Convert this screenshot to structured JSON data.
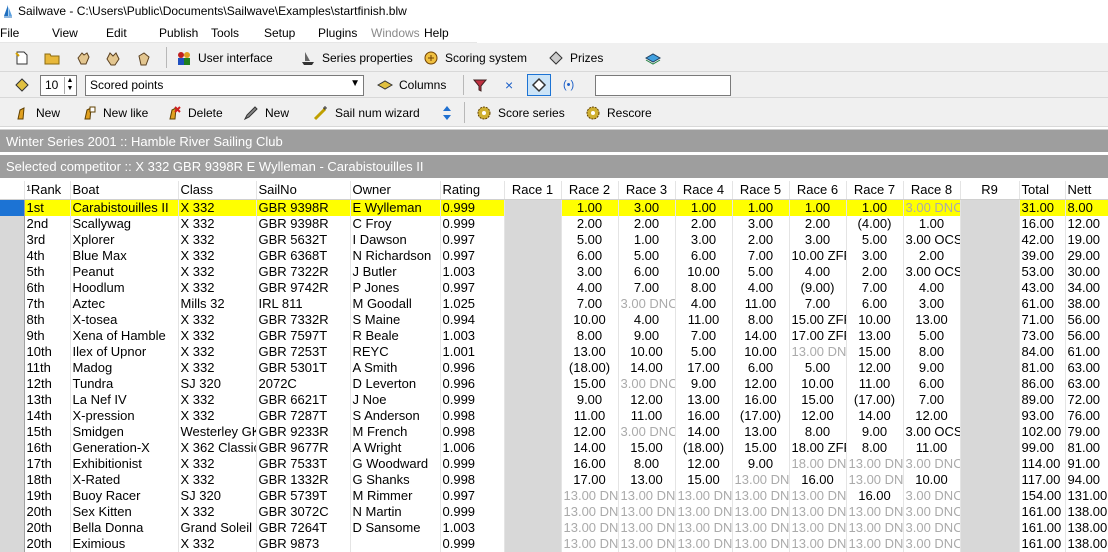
{
  "window": {
    "title": "Sailwave - C:\\Users\\Public\\Documents\\Sailwave\\Examples\\startfinish.blw"
  },
  "menu": [
    "File",
    "View",
    "Edit",
    "Publish",
    "Tools",
    "Setup",
    "Plugins",
    "Windows",
    "Help"
  ],
  "toolbar1": {
    "ui_label": "User interface",
    "series_props_label": "Series properties",
    "scoring_label": "Scoring system",
    "prizes_label": "Prizes"
  },
  "toolbar2": {
    "count": "10",
    "view_select": "Scored points",
    "columns_label": "Columns",
    "x_symbol": "×",
    "paren_symbol": "(•)",
    "search_value": ""
  },
  "toolbar3": {
    "new_label": "New",
    "new_like_label": "New like",
    "delete_label": "Delete",
    "new2_label": "New",
    "wizard_label": "Sail num wizard",
    "score_label": "Score series",
    "rescore_label": "Rescore"
  },
  "series_title": "Winter Series 2001 :: Hamble River Sailing Club",
  "selected_text": "Selected competitor :: X 332 GBR 9398R E Wylleman - Carabistouilles II",
  "columns": [
    "¹Rank",
    "Boat",
    "Class",
    "SailNo",
    "Owner",
    "Rating",
    "Race 1",
    "Race 2",
    "Race 3",
    "Race 4",
    "Race 5",
    "Race 6",
    "Race 7",
    "Race 8",
    "R9",
    "Total",
    "Nett"
  ],
  "rows": [
    [
      "1st",
      "Carabistouilles II",
      "X 332",
      "GBR 9398R",
      "E Wylleman",
      "0.999",
      "",
      "1.00",
      "3.00",
      "1.00",
      "1.00",
      "1.00",
      "1.00",
      "3.00 DNC",
      "",
      "31.00",
      "8.00"
    ],
    [
      "2nd",
      "Scallywag",
      "X 332",
      "GBR 9398R",
      "C Froy",
      "0.999",
      "",
      "2.00",
      "2.00",
      "2.00",
      "3.00",
      "2.00",
      "(4.00)",
      "1.00",
      "",
      "16.00",
      "12.00"
    ],
    [
      "3rd",
      "Xplorer",
      "X 332",
      "GBR 5632T",
      "I Dawson",
      "0.997",
      "",
      "5.00",
      "1.00",
      "3.00",
      "2.00",
      "3.00",
      "5.00",
      "3.00 OCS",
      "",
      "42.00",
      "19.00"
    ],
    [
      "4th",
      "Blue Max",
      "X 332",
      "GBR 6368T",
      "N Richardson",
      "0.997",
      "",
      "6.00",
      "5.00",
      "6.00",
      "7.00",
      "10.00 ZFP",
      "3.00",
      "2.00",
      "",
      "39.00",
      "29.00"
    ],
    [
      "5th",
      "Peanut",
      "X 332",
      "GBR 7322R",
      "J Butler",
      "1.003",
      "",
      "3.00",
      "6.00",
      "10.00",
      "5.00",
      "4.00",
      "2.00",
      "3.00 OCS",
      "",
      "53.00",
      "30.00"
    ],
    [
      "6th",
      "Hoodlum",
      "X 332",
      "GBR 9742R",
      "P Jones",
      "0.997",
      "",
      "4.00",
      "7.00",
      "8.00",
      "4.00",
      "(9.00)",
      "7.00",
      "4.00",
      "",
      "43.00",
      "34.00"
    ],
    [
      "7th",
      "Aztec",
      "Mills 32",
      "IRL 811",
      "M Goodall",
      "1.025",
      "",
      "7.00",
      "3.00 DNC",
      "4.00",
      "11.00",
      "7.00",
      "6.00",
      "3.00",
      "",
      "61.00",
      "38.00"
    ],
    [
      "8th",
      "X-tosea",
      "X 332",
      "GBR 7332R",
      "S Maine",
      "0.994",
      "",
      "10.00",
      "4.00",
      "11.00",
      "8.00",
      "15.00 ZFP",
      "10.00",
      "13.00",
      "",
      "71.00",
      "56.00"
    ],
    [
      "9th",
      "Xena of Hamble",
      "X 332",
      "GBR 7597T",
      "R Beale",
      "1.003",
      "",
      "8.00",
      "9.00",
      "7.00",
      "14.00",
      "17.00 ZFP",
      "13.00",
      "5.00",
      "",
      "73.00",
      "56.00"
    ],
    [
      "10th",
      "Ilex of Upnor",
      "X 332",
      "GBR 7253T",
      "REYC",
      "1.001",
      "",
      "13.00",
      "10.00",
      "5.00",
      "10.00",
      "13.00 DNC",
      "15.00",
      "8.00",
      "",
      "84.00",
      "61.00"
    ],
    [
      "11th",
      "Madog",
      "X 332",
      "GBR 5301T",
      "A Smith",
      "0.996",
      "",
      "(18.00)",
      "14.00",
      "17.00",
      "6.00",
      "5.00",
      "12.00",
      "9.00",
      "",
      "81.00",
      "63.00"
    ],
    [
      "12th",
      "Tundra",
      "SJ 320",
      "2072C",
      "D Leverton",
      "0.996",
      "",
      "15.00",
      "3.00 DNC",
      "9.00",
      "12.00",
      "10.00",
      "11.00",
      "6.00",
      "",
      "86.00",
      "63.00"
    ],
    [
      "13th",
      "La Nef IV",
      "X 332",
      "GBR 6621T",
      "J Noe",
      "0.999",
      "",
      "9.00",
      "12.00",
      "13.00",
      "16.00",
      "15.00",
      "(17.00)",
      "7.00",
      "",
      "89.00",
      "72.00"
    ],
    [
      "14th",
      "X-pression",
      "X 332",
      "GBR 7287T",
      "S Anderson",
      "0.998",
      "",
      "11.00",
      "11.00",
      "16.00",
      "(17.00)",
      "12.00",
      "14.00",
      "12.00",
      "",
      "93.00",
      "76.00"
    ],
    [
      "15th",
      "Smidgen",
      "Westerley GK",
      "GBR 9233R",
      "M French",
      "0.998",
      "",
      "12.00",
      "3.00 DNC",
      "14.00",
      "13.00",
      "8.00",
      "9.00",
      "3.00 OCS",
      "",
      "102.00",
      "79.00"
    ],
    [
      "16th",
      "Generation-X",
      "X 362 Classic",
      "GBR 9677R",
      "A Wright",
      "1.006",
      "",
      "14.00",
      "15.00",
      "(18.00)",
      "15.00",
      "18.00 ZFP",
      "8.00",
      "11.00",
      "",
      "99.00",
      "81.00"
    ],
    [
      "17th",
      "Exhibitionist",
      "X 332",
      "GBR 7533T",
      "G Woodward",
      "0.999",
      "",
      "16.00",
      "8.00",
      "12.00",
      "9.00",
      "18.00 DNC",
      "13.00 DNF",
      "3.00 DNC",
      "",
      "114.00",
      "91.00"
    ],
    [
      "18th",
      "X-Rated",
      "X 332",
      "GBR 1332R",
      "G Shanks",
      "0.998",
      "",
      "17.00",
      "13.00",
      "15.00",
      "13.00 DNC",
      "16.00",
      "13.00 DNF",
      "10.00",
      "",
      "117.00",
      "94.00"
    ],
    [
      "19th",
      "Buoy Racer",
      "SJ 320",
      "GBR 5739T",
      "M Rimmer",
      "0.997",
      "",
      "13.00 DNC",
      "13.00 DNC",
      "13.00 DNC",
      "13.00 DNC",
      "13.00 DNC",
      "16.00",
      "3.00 DNC",
      "",
      "154.00",
      "131.00"
    ],
    [
      "20th",
      "Sex Kitten",
      "X 332",
      "GBR 3072C",
      "N Martin",
      "0.999",
      "",
      "13.00 DNC",
      "13.00 DNF",
      "13.00 DNC",
      "13.00 DNC",
      "13.00 DNC",
      "13.00 DNC",
      "3.00 DNC",
      "",
      "161.00",
      "138.00"
    ],
    [
      "20th",
      "Bella Donna",
      "Grand Soleil",
      "GBR 7264T",
      "D Sansome",
      "1.003",
      "",
      "13.00 DNC",
      "13.00 DNC",
      "13.00 DNC",
      "13.00 DNC",
      "13.00 DNC",
      "13.00 DNC",
      "3.00 DNC",
      "",
      "161.00",
      "138.00"
    ],
    [
      "20th",
      "Eximious",
      "X 332",
      "GBR 9873",
      "",
      "0.999",
      "",
      "13.00 DNC",
      "13.00 DNC",
      "13.00 DNC",
      "13.00 DNC",
      "13.00 DNC",
      "13.00 DNC",
      "3.00 DNC",
      "",
      "161.00",
      "138.00"
    ]
  ],
  "colors": {
    "highlight": "#ffff00",
    "selector": "#1c73d4",
    "header_bar": "#9e9e9e"
  }
}
